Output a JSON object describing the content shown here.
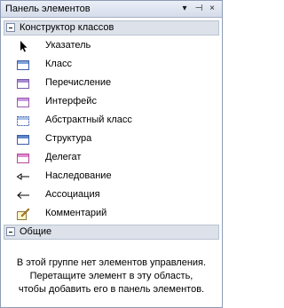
{
  "panel": {
    "title": "Панель элементов",
    "buttons": {
      "menu": "▾",
      "pin": "⊣",
      "close": "×"
    }
  },
  "groups": [
    {
      "name": "Конструктор классов",
      "items": [
        {
          "label": "Указатель",
          "icon": "pointer-icon"
        },
        {
          "label": "Класс",
          "icon": "class-icon"
        },
        {
          "label": "Перечисление",
          "icon": "enum-icon"
        },
        {
          "label": "Интерфейс",
          "icon": "interface-icon"
        },
        {
          "label": "Абстрактный класс",
          "icon": "abstract-class-icon"
        },
        {
          "label": "Структура",
          "icon": "struct-icon"
        },
        {
          "label": "Делегат",
          "icon": "delegate-icon"
        },
        {
          "label": "Наследование",
          "icon": "inheritance-arrow-icon"
        },
        {
          "label": "Ассоциация",
          "icon": "association-arrow-icon"
        },
        {
          "label": "Комментарий",
          "icon": "comment-icon"
        }
      ]
    },
    {
      "name": "Общие",
      "empty_message": [
        "В этой группе нет элементов управления.",
        "Перетащите элемент в эту область,",
        "чтобы добавить его в панель элементов."
      ]
    }
  ]
}
